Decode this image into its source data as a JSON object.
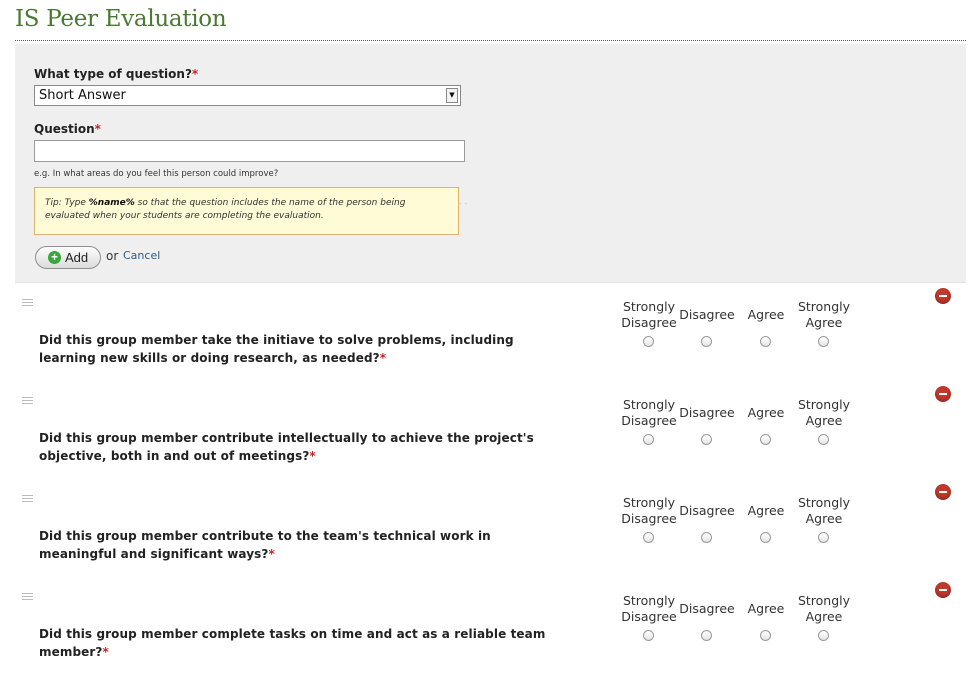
{
  "page": {
    "title": "IS Peer Evaluation"
  },
  "form": {
    "type_label": "What type of question?",
    "required_mark": "*",
    "type_selected": "Short Answer",
    "question_label": "Question",
    "question_value": "",
    "hint": "e.g. In what areas do you feel this person could improve?",
    "tip_prefix": "Tip: Type ",
    "tip_token": "%name%",
    "tip_suffix": " so that the question includes the name of the person being evaluated when your students are completing the evaluation.",
    "add_label": "Add",
    "or_text": "or",
    "cancel_label": "Cancel"
  },
  "scale": [
    "Strongly\nDisagree",
    "Disagree",
    "Agree",
    "Strongly\nAgree"
  ],
  "questions": [
    {
      "text": "Did this group member take the initiave to solve problems, including learning new skills or doing research, as needed?"
    },
    {
      "text": "Did this group member contribute intellectually to achieve the project's objective, both in and out of meetings?"
    },
    {
      "text": "Did this group member contribute to the team's technical work in meaningful and significant ways?"
    },
    {
      "text": "Did this group member complete tasks on time and act as a reliable team member?"
    }
  ],
  "icons": {
    "add": "plus-circle-icon",
    "remove": "minus-circle-icon",
    "handle": "drag-handle-icon",
    "select_arrow": "chevron-down-icon"
  },
  "colors": {
    "title": "#4a7a32",
    "required": "#cc2222",
    "remove": "#c0392b",
    "add": "#33a93a",
    "tip_bg": "#fefbd6",
    "tip_border": "#e0b36e"
  }
}
